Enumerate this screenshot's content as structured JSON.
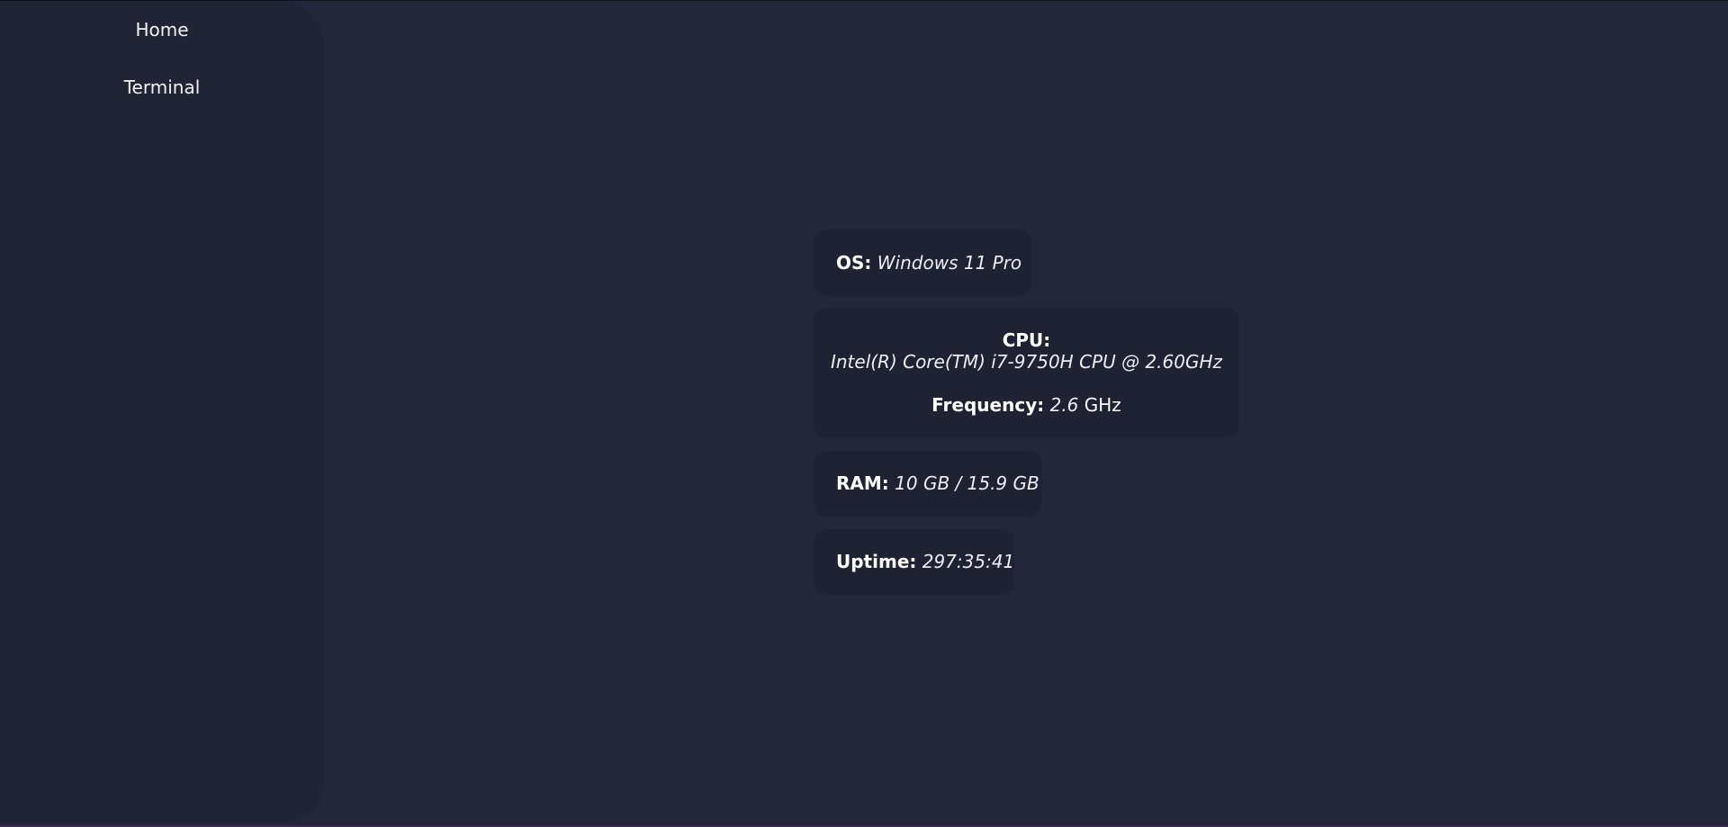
{
  "sidebar": {
    "items": [
      {
        "label": "Home"
      },
      {
        "label": "Terminal"
      }
    ]
  },
  "system_info": {
    "os": {
      "label": "OS:",
      "value": "Windows 11 Pro"
    },
    "cpu": {
      "label": "CPU:",
      "model": "Intel(R) Core(TM) i7-9750H CPU @ 2.60GHz",
      "frequency_label": "Frequency:",
      "frequency_value": "2.6",
      "frequency_unit": "GHz"
    },
    "ram": {
      "label": "RAM:",
      "value": "10 GB / 15.9 GB"
    },
    "uptime": {
      "label": "Uptime:",
      "value": "297:35:41"
    }
  },
  "colors": {
    "background": "#232739",
    "sidebar": "#202435",
    "card": "#1f2233",
    "text": "#ffffff"
  }
}
